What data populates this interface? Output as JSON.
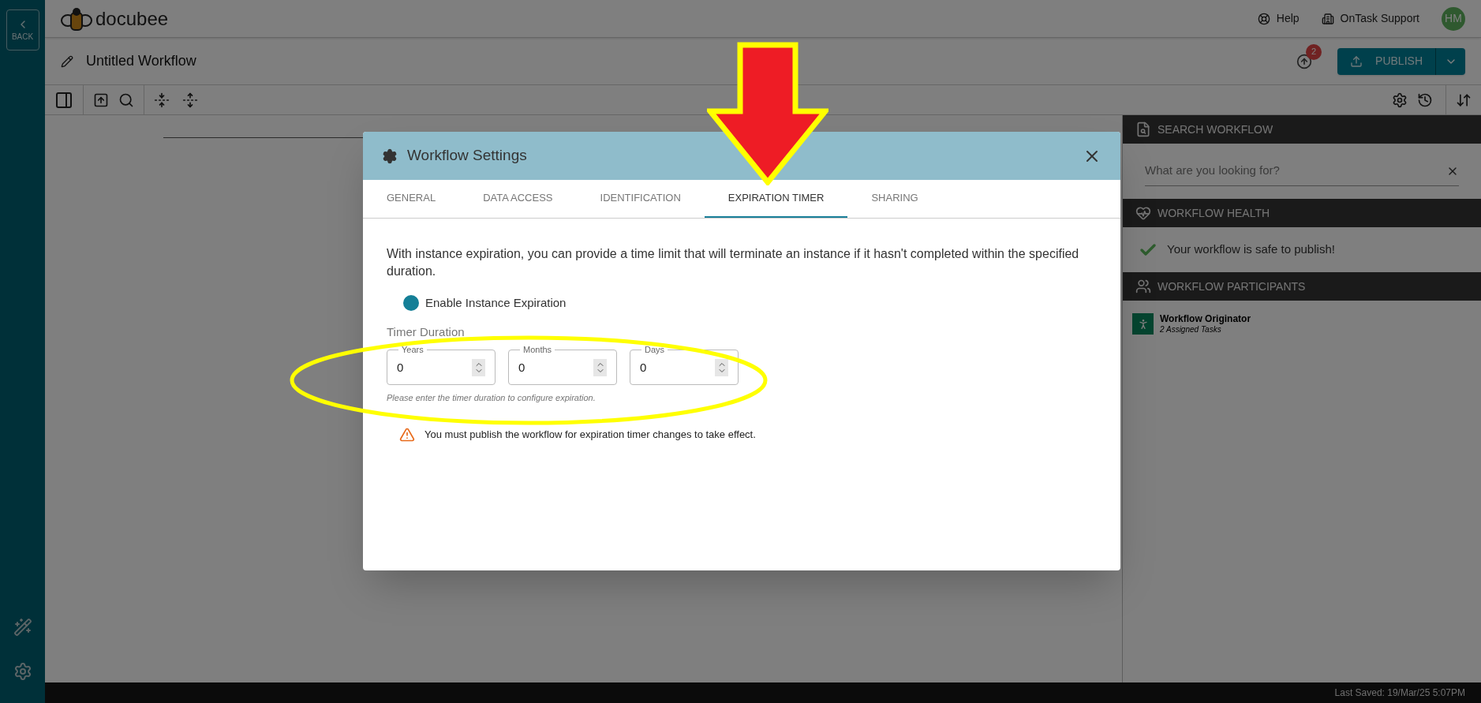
{
  "sidebar": {
    "back_label": "BACK"
  },
  "header": {
    "logo_text": "docubee",
    "links": [
      {
        "kind": "help",
        "label": "Help"
      },
      {
        "kind": "org",
        "label": "OnTask Support"
      }
    ],
    "avatar": "HM"
  },
  "workflow": {
    "title": "Untitled Workflow",
    "notification_count": "2",
    "publish_label": "PUBLISH"
  },
  "dialog": {
    "title": "Workflow Settings",
    "tabs": [
      {
        "label": "GENERAL",
        "selected": false
      },
      {
        "label": "DATA ACCESS",
        "selected": false
      },
      {
        "label": "IDENTIFICATION",
        "selected": false
      },
      {
        "label": "EXPIRATION TIMER",
        "selected": true
      },
      {
        "label": "SHARING",
        "selected": false
      }
    ],
    "description": "With instance expiration, you can provide a time limit that will terminate an instance if it hasn't completed within the specified duration.",
    "toggle": {
      "label": "Enable Instance Expiration",
      "on": true
    },
    "duration_label": "Timer Duration",
    "fields": [
      {
        "label": "Years",
        "value": "0"
      },
      {
        "label": "Months",
        "value": "0"
      },
      {
        "label": "Days",
        "value": "0"
      }
    ],
    "hint": "Please enter the timer duration to configure expiration.",
    "warning": "You must publish the workflow for expiration timer changes to take effect."
  },
  "right_panel": {
    "sections": [
      {
        "kind": "search",
        "title": "SEARCH WORKFLOW",
        "placeholder": "What are you looking for?"
      },
      {
        "kind": "health",
        "title": "WORKFLOW HEALTH",
        "message": "Your workflow is safe to publish!"
      },
      {
        "kind": "participants",
        "title": "WORKFLOW PARTICIPANTS",
        "participants": [
          {
            "name": "Workflow Originator",
            "detail": "2 Assigned Tasks"
          }
        ]
      }
    ]
  },
  "status_bar": {
    "text": "Last Saved: 19/Mar/25 5:07PM"
  }
}
